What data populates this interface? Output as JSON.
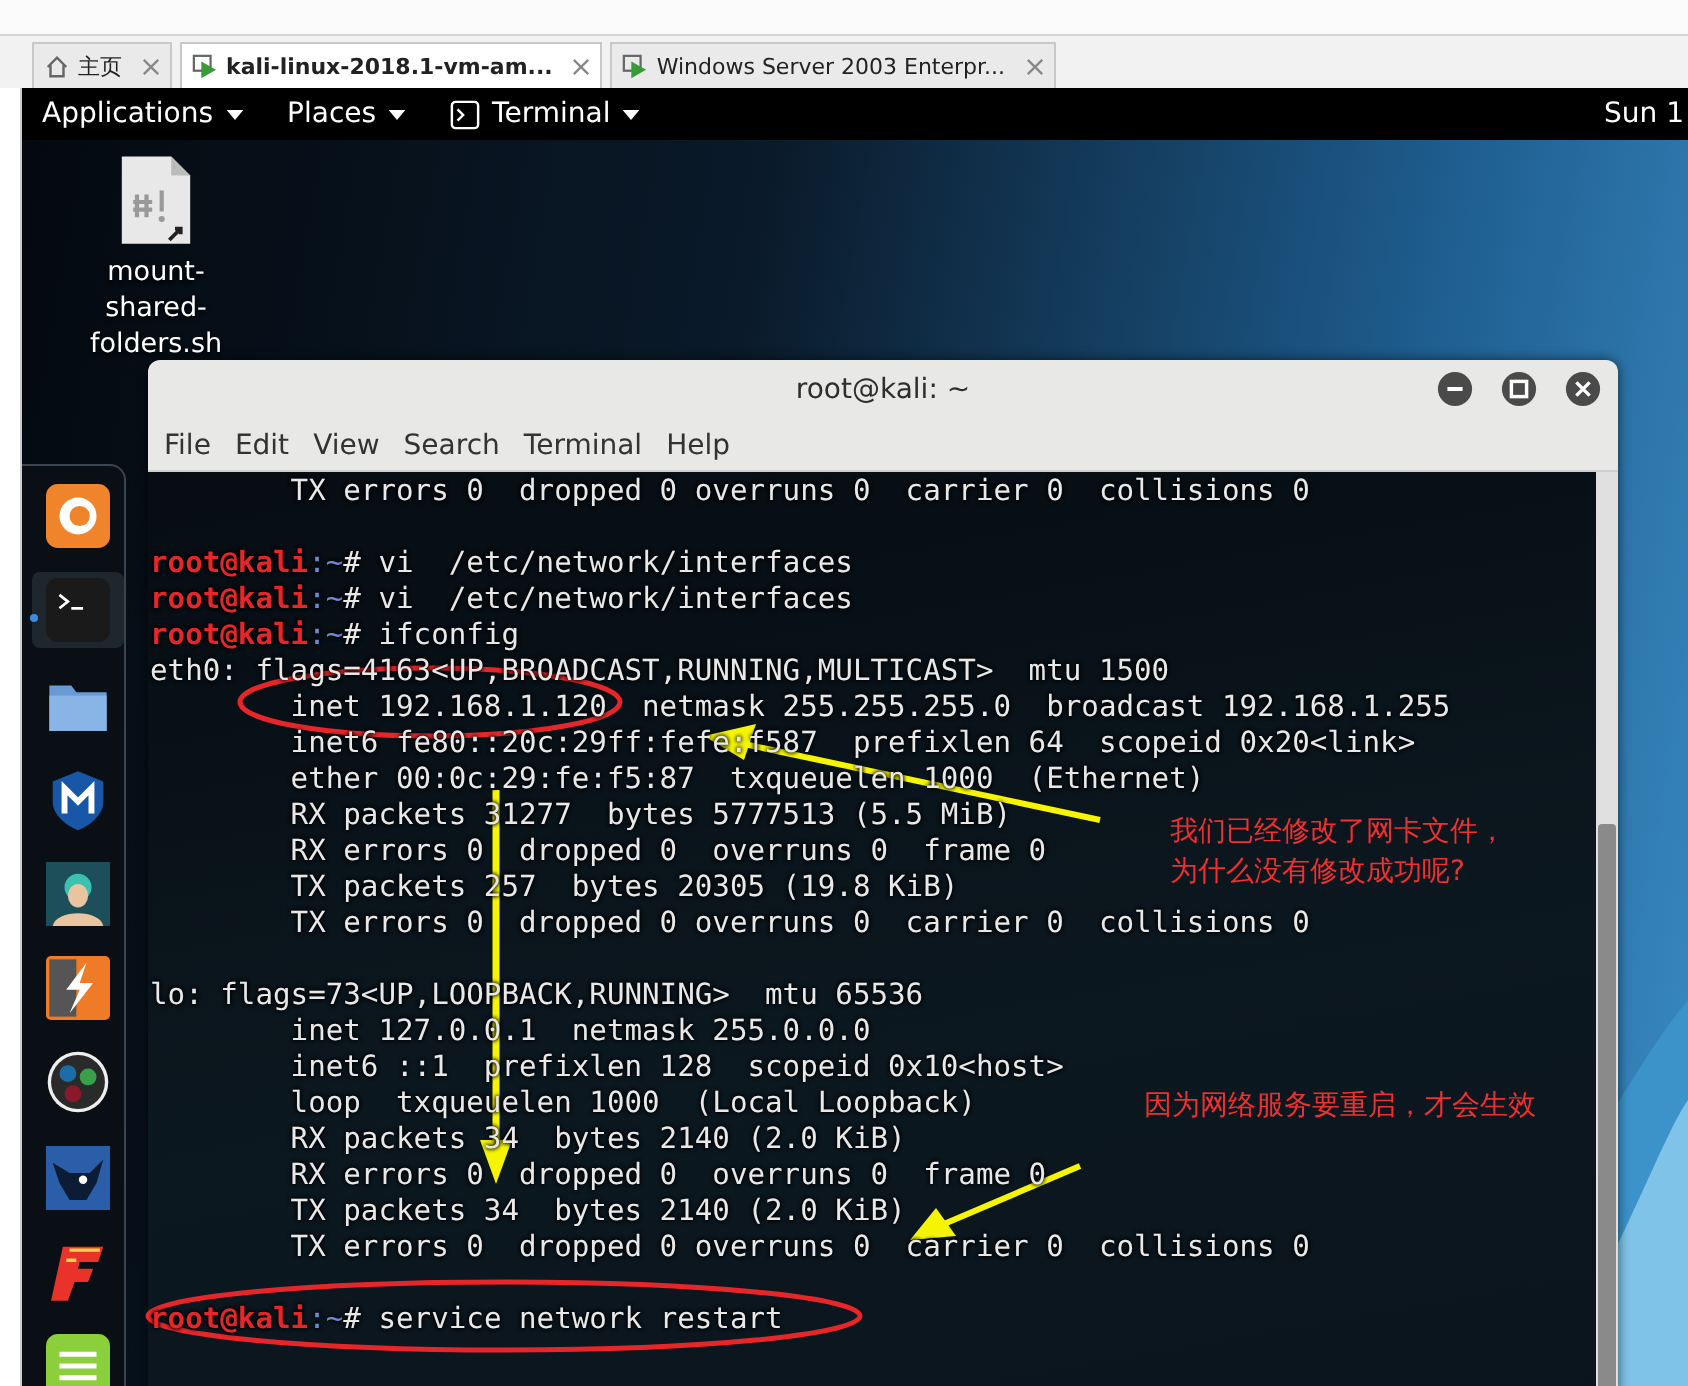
{
  "tabs": [
    {
      "label": "主页",
      "kind": "home",
      "selected": false
    },
    {
      "label": "kali-linux-2018.1-vm-am...",
      "kind": "vm",
      "selected": true
    },
    {
      "label": "Windows Server 2003 Enterpr...",
      "kind": "vm",
      "selected": false
    }
  ],
  "top_bar": {
    "menus": [
      {
        "label": "Applications",
        "kind": "plain"
      },
      {
        "label": "Places",
        "kind": "plain"
      },
      {
        "label": "Terminal",
        "kind": "terminal"
      }
    ],
    "clock": "Sun 1"
  },
  "desktop_icon": {
    "label_lines": [
      "mount-",
      "shared-",
      "folders.sh"
    ]
  },
  "dock_items": [
    {
      "selected": false
    },
    {
      "selected": true
    },
    {
      "selected": false
    },
    {
      "selected": false
    },
    {
      "selected": false
    },
    {
      "selected": false
    },
    {
      "selected": false
    },
    {
      "selected": false
    },
    {
      "selected": false
    },
    {
      "selected": false
    }
  ],
  "terminal": {
    "title": "root@kali: ~",
    "menu": [
      "File",
      "Edit",
      "View",
      "Search",
      "Terminal",
      "Help"
    ],
    "lines": [
      {
        "kind": "output",
        "text": "        TX errors 0  dropped 0 overruns 0  carrier 0  collisions 0"
      },
      {
        "kind": "blank"
      },
      {
        "kind": "prompt",
        "user": "root@kali",
        "path": ":~",
        "mark": "# ",
        "command": "vi  /etc/network/interfaces"
      },
      {
        "kind": "prompt",
        "user": "root@kali",
        "path": ":~",
        "mark": "# ",
        "command": "vi  /etc/network/interfaces"
      },
      {
        "kind": "prompt",
        "user": "root@kali",
        "path": ":~",
        "mark": "# ",
        "command": "ifconfig"
      },
      {
        "kind": "output",
        "text": "eth0: flags=4163<UP,BROADCAST,RUNNING,MULTICAST>  mtu 1500"
      },
      {
        "kind": "output",
        "text": "        inet 192.168.1.120  netmask 255.255.255.0  broadcast 192.168.1.255"
      },
      {
        "kind": "output",
        "text": "        inet6 fe80::20c:29ff:fefe:f587  prefixlen 64  scopeid 0x20<link>"
      },
      {
        "kind": "output",
        "text": "        ether 00:0c:29:fe:f5:87  txqueuelen 1000  (Ethernet)"
      },
      {
        "kind": "output",
        "text": "        RX packets 31277  bytes 5777513 (5.5 MiB)"
      },
      {
        "kind": "output",
        "text": "        RX errors 0  dropped 0  overruns 0  frame 0"
      },
      {
        "kind": "output",
        "text": "        TX packets 257  bytes 20305 (19.8 KiB)"
      },
      {
        "kind": "output",
        "text": "        TX errors 0  dropped 0 overruns 0  carrier 0  collisions 0"
      },
      {
        "kind": "blank"
      },
      {
        "kind": "output",
        "text": "lo: flags=73<UP,LOOPBACK,RUNNING>  mtu 65536"
      },
      {
        "kind": "output",
        "text": "        inet 127.0.0.1  netmask 255.0.0.0"
      },
      {
        "kind": "output",
        "text": "        inet6 ::1  prefixlen 128  scopeid 0x10<host>"
      },
      {
        "kind": "output",
        "text": "        loop  txqueuelen 1000  (Local Loopback)"
      },
      {
        "kind": "output",
        "text": "        RX packets 34  bytes 2140 (2.0 KiB)"
      },
      {
        "kind": "output",
        "text": "        RX errors 0  dropped 0  overruns 0  frame 0"
      },
      {
        "kind": "output",
        "text": "        TX packets 34  bytes 2140 (2.0 KiB)"
      },
      {
        "kind": "output",
        "text": "        TX errors 0  dropped 0 overruns 0  carrier 0  collisions 0"
      },
      {
        "kind": "blank"
      },
      {
        "kind": "prompt",
        "user": "root@kali",
        "path": ":~",
        "mark": "# ",
        "command": "service network restart"
      }
    ]
  },
  "annotations": [
    {
      "lines": [
        "我们已经修改了网卡文件，",
        "为什么没有修改成功呢?"
      ]
    },
    {
      "lines": [
        "因为网络服务要重启，才会生效"
      ]
    }
  ]
}
